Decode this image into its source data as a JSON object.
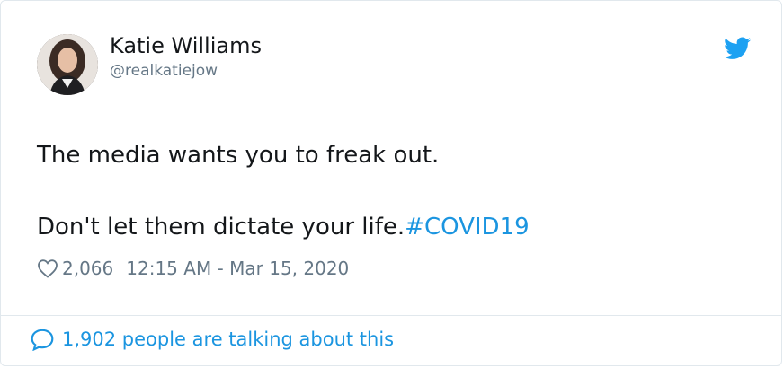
{
  "tweet": {
    "author_name": "Katie Williams",
    "author_handle": "@realkatiejow",
    "text_line1": "The media wants you to freak out.",
    "text_line2": "Don't let them dictate your life.",
    "hashtag": "#COVID19",
    "likes": "2,066",
    "timestamp": "12:15 AM - Mar 15, 2020",
    "talking": "1,902 people are talking about this"
  },
  "colors": {
    "accent": "#1b95e0",
    "text": "#14171a",
    "muted": "#657786",
    "border": "#e1e8ed"
  },
  "icons": {
    "brand": "twitter-bird-icon",
    "like": "heart-icon",
    "reply": "speech-bubble-icon"
  }
}
